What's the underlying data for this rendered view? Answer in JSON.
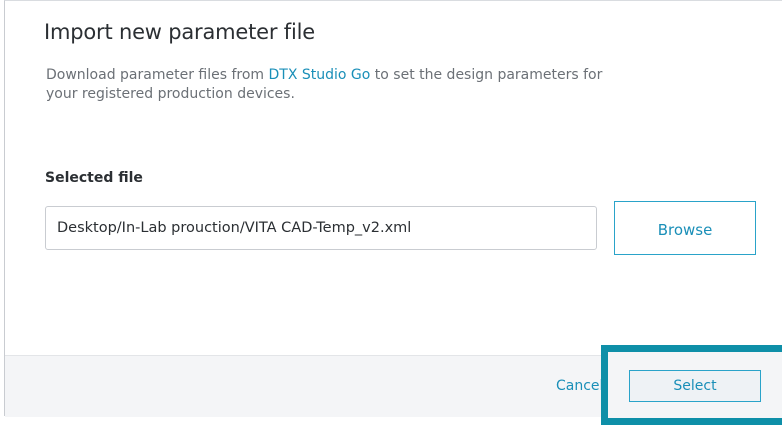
{
  "dialog": {
    "title": "Import new parameter file",
    "description_prefix": "Download parameter files from ",
    "description_link": "DTX Studio Go",
    "description_suffix": " to set the design parameters for your registered production devices.",
    "selected_file_label": "Selected file",
    "selected_file_value": "Desktop/In-Lab prouction/VITA CAD-Temp_v2.xml",
    "browse_label": "Browse"
  },
  "footer": {
    "cancel_label": "Cancel",
    "select_label": "Select"
  },
  "colors": {
    "accent": "#1a8fb8",
    "highlight": "#0e8fa8",
    "footer_bg": "#f4f5f7"
  }
}
